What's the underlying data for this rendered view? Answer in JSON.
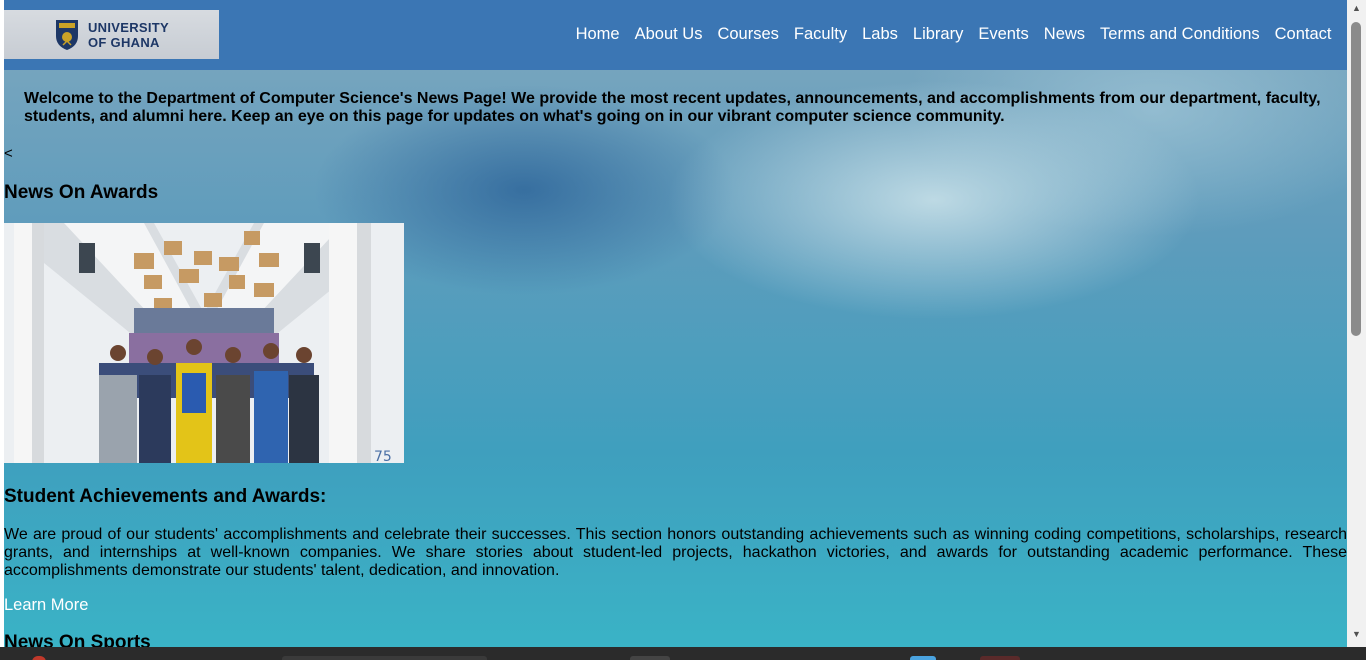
{
  "logo": {
    "line1": "UNIVERSITY",
    "line2": "OF GHANA"
  },
  "nav": {
    "items": [
      {
        "label": "Home"
      },
      {
        "label": "About Us"
      },
      {
        "label": "Courses"
      },
      {
        "label": "Faculty"
      },
      {
        "label": "Labs"
      },
      {
        "label": "Library"
      },
      {
        "label": "Events"
      },
      {
        "label": "News"
      },
      {
        "label": "Terms and Conditions"
      },
      {
        "label": "Contact"
      }
    ]
  },
  "intro": {
    "text": "Welcome to the Department of Computer Science's News Page! We provide the most recent updates, announcements, and accomplishments from our department, faculty, students, and alumni here. Keep an eye on this page for updates on what's going on in our vibrant computer science community."
  },
  "stray_text": "<",
  "awards": {
    "heading": "News On Awards",
    "subheading": "Student Achievements and Awards:",
    "body": "We are proud of our students' accomplishments and celebrate their successes. This section honors outstanding achievements such as winning coding competitions, scholarships, research grants, and internships at well-known companies. We share stories about student-led projects, hackathon victories, and awards for outstanding academic performance. These accomplishments demonstrate our students' talent, dedication, and innovation.",
    "link": "Learn More"
  },
  "sports": {
    "heading": "News On Sports"
  },
  "colors": {
    "navbar": "#3b76b4",
    "link": "#ffffff"
  }
}
